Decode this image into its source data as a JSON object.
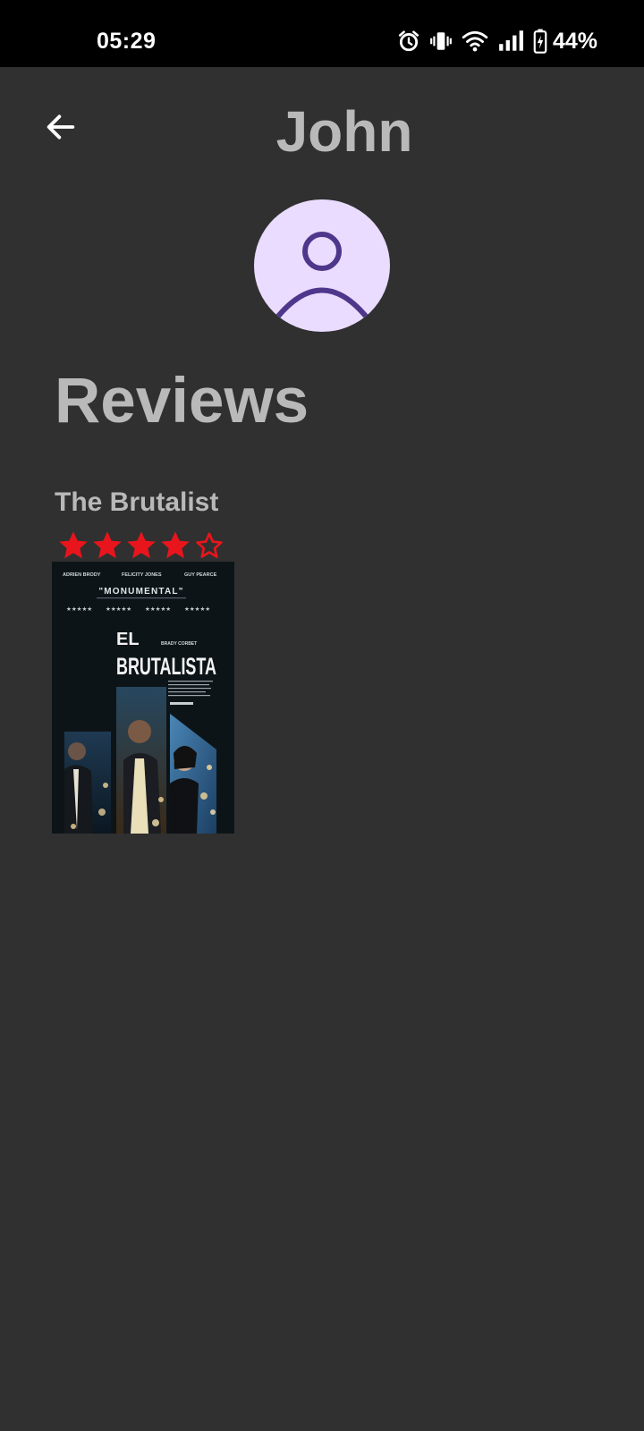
{
  "status_bar": {
    "time": "05:29",
    "battery_percent": "44%",
    "icons": [
      "alarm-icon",
      "vibrate-icon",
      "wifi-icon",
      "signal-icon",
      "battery-charging-icon"
    ]
  },
  "header": {
    "back_icon": "arrow-left-icon",
    "title": "John"
  },
  "avatar": {
    "icon": "person-icon",
    "bg_color": "#eadcff",
    "fg_color": "#4e378b"
  },
  "reviews": {
    "heading": "Reviews",
    "items": [
      {
        "title": "The Brutalist",
        "rating": 4,
        "rating_max": 5,
        "poster": {
          "top_names": [
            "ADRIEN BRODY",
            "FELICITY JONES",
            "GUY PEARCE"
          ],
          "quote": "\"MONUMENTAL\"",
          "title_line1": "EL",
          "title_line2": "BRUTALISTA",
          "director": "BRADY CORBET"
        }
      }
    ]
  },
  "colors": {
    "background": "#303030",
    "text_muted": "#b9b9b9",
    "star": "#e8151c"
  }
}
